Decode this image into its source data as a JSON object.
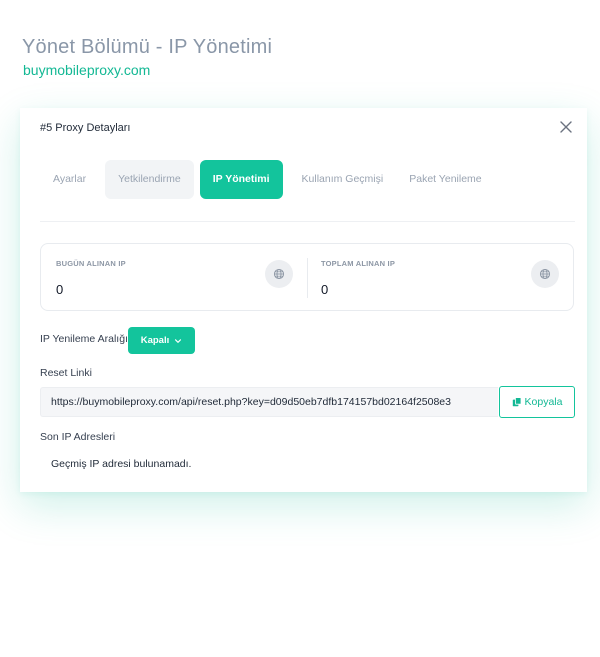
{
  "page": {
    "heading": "Yönet Bölümü - IP Yönetimi",
    "site": "buymobileproxy.com"
  },
  "modal": {
    "title": "#5 Proxy Detayları",
    "close_icon": "close-icon",
    "tabs": [
      {
        "label": "Ayarlar",
        "state": "normal"
      },
      {
        "label": "Yetkilendirme",
        "state": "hover"
      },
      {
        "label": "IP Yönetimi",
        "state": "active"
      },
      {
        "label": "Kullanım Geçmişi",
        "state": "normal"
      },
      {
        "label": "Paket Yenileme",
        "state": "normal"
      }
    ],
    "stats": {
      "today": {
        "label": "BUGÜN ALINAN IP",
        "value": "0",
        "icon": "globe-icon"
      },
      "total": {
        "label": "TOPLAM ALINAN IP",
        "value": "0",
        "icon": "globe-icon"
      }
    },
    "interval": {
      "label": "IP Yenileme Aralığı",
      "value": "Kapalı",
      "icon": "chevron-down-icon"
    },
    "reset": {
      "label": "Reset Linki",
      "url": "https://buymobileproxy.com/api/reset.php?key=d09d50eb7dfb174157bd02164f2508e3",
      "copy_label": "Kopyala",
      "copy_icon": "copy-icon"
    },
    "recent": {
      "label": "Son IP Adresleri",
      "empty": "Geçmiş IP adresi bulunamadı."
    }
  },
  "colors": {
    "accent": "#13c49c",
    "heading": "#8a97a8"
  }
}
